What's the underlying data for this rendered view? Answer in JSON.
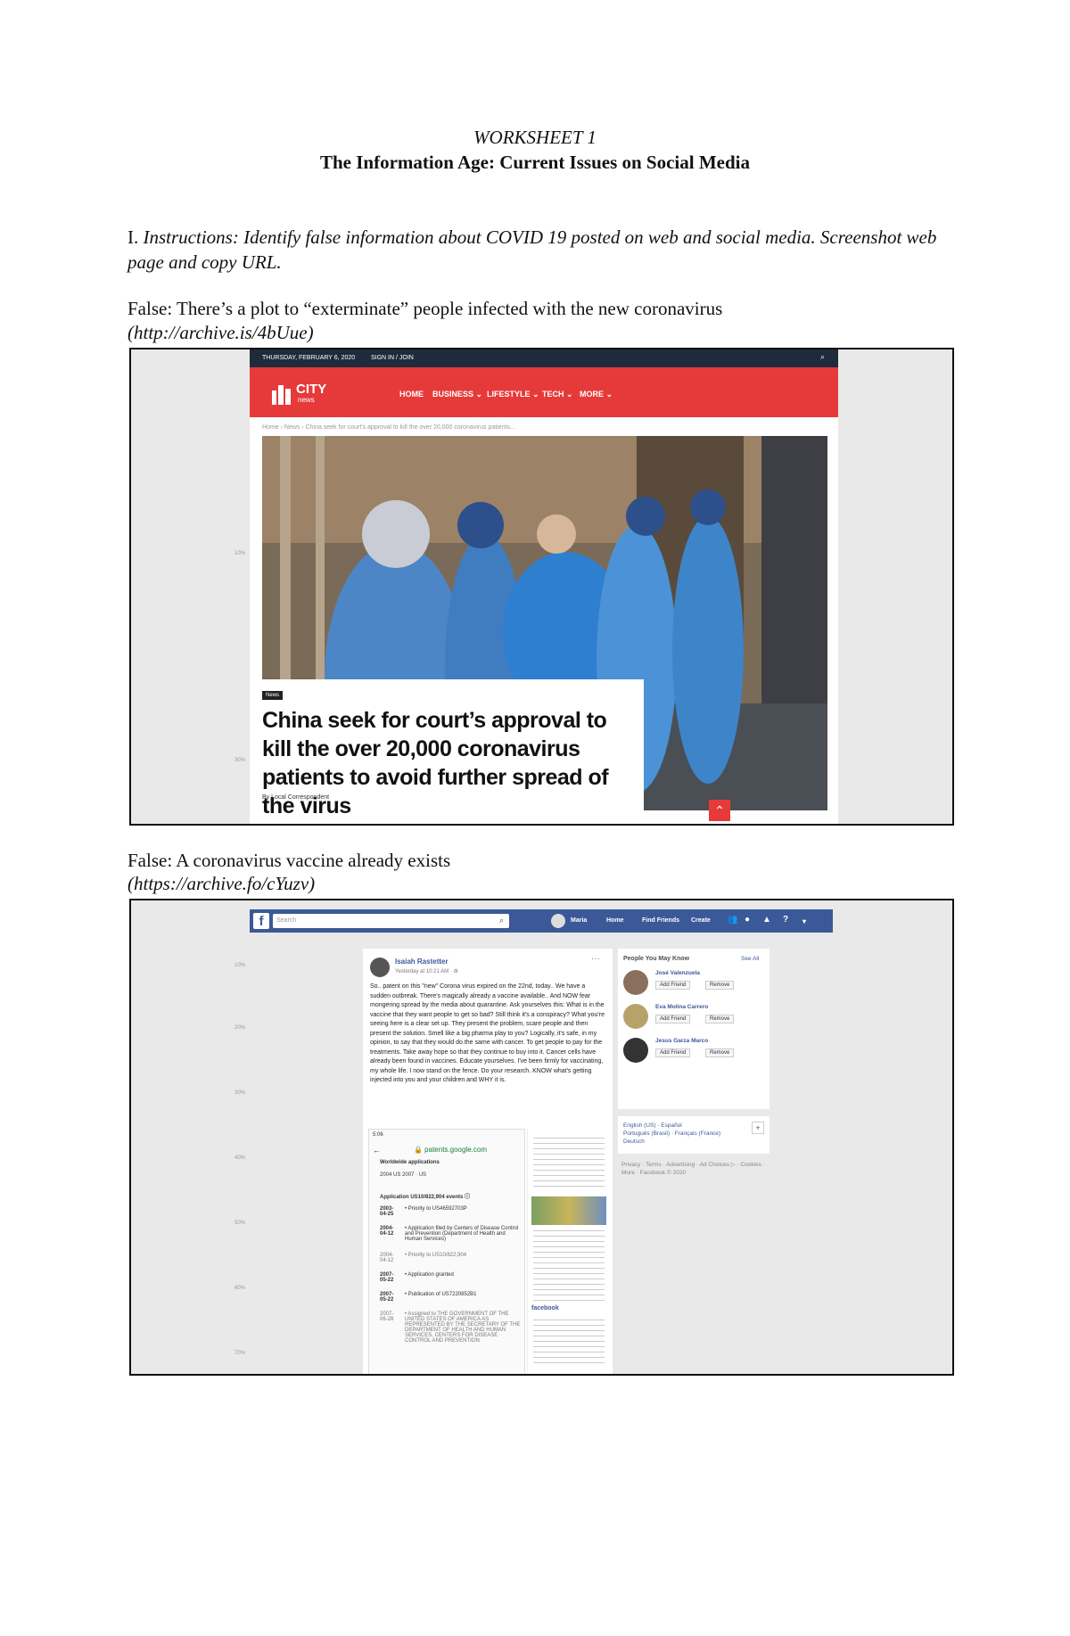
{
  "worksheet": {
    "title": "WORKSHEET 1",
    "subtitle": "The Information Age: Current Issues on Social Media",
    "instructions_number": "I.",
    "instructions_text": "Instructions: Identify false information about COVID 19 posted on web and social media. Screenshot web page and copy URL."
  },
  "items": [
    {
      "claim": "False: There’s a plot to “exterminate” people infected with the new coronavirus",
      "url": "(http://archive.is/4bUue)"
    },
    {
      "claim": "False: A coronavirus vaccine already exists",
      "url": "(https://archive.fo/cYuzv)"
    }
  ],
  "shot1": {
    "date": "THURSDAY, FEBRUARY 6, 2020",
    "signin": "SIGN IN / JOIN",
    "logo_top": "CITY",
    "logo_bottom": "news",
    "menu": [
      "HOME",
      "BUSINESS ⌄",
      "LIFESTYLE ⌄",
      "TECH ⌄",
      "MORE ⌄"
    ],
    "breadcrumb": "Home  ›  News  ›  China seek for court's approval to kill the over 20,000 coronavirus patients...",
    "badge": "News",
    "headline": "China seek for court’s approval to kill the over 20,000 coronavirus patients to avoid further spread of the virus",
    "author": "By  Local Correspondent",
    "side_ticks": [
      "10%",
      "30%"
    ]
  },
  "shot2": {
    "search_placeholder": "Search",
    "nav": [
      "Maria",
      "Home",
      "Find Friends",
      "Create"
    ],
    "poster": "Isaiah Rastetter",
    "time": "Yesterday at 10:21 AM · ⚙",
    "post_text": "So.. patent on this \"new\" Corona virus expired on the 22nd, today.. We have a sudden outbreak. There's magically already a vaccine available.. And NOW fear mongering spread by the media about quarantine. Ask yourselves this: What is in the vaccine that they want people to get so bad? Still think it's a conspiracy? What you're seeing here is a clear set up. They present the problem, scare people and then present the solution. Smell like a big pharma play to you? Logically, it's safe, in my opinion, to say that they would do the same with cancer. To get people to pay for the treatments. Take away hope so that they continue to buy into it. Cancer cells have already been found in vaccines. Educate yourselves. I've been firmly for vaccinating, my whole life. I now stand on the fence. Do your research. KNOW what's getting injected into you and your children and WHY it is.",
    "phone": {
      "clock": "5:06",
      "site": "🔒 patents.google.com",
      "section": "Worldwide applications",
      "years": "2004  US  2007 · US",
      "events_title": "Application US10/822,904 events ⓘ",
      "events": [
        {
          "date": "2003-04-25",
          "text": "• Priority to US46592703P"
        },
        {
          "date": "2004-04-12",
          "text": "• Application filed by Centers of Disease Control and Prevention (Department of Health and Human Services)"
        },
        {
          "date": "2004-04-12",
          "text": "• Priority to US10/822,904"
        },
        {
          "date": "2007-05-22",
          "text": "• Application granted"
        },
        {
          "date": "2007-05-22",
          "text": "• Publication of US7220852B1"
        },
        {
          "date": "2007-06-28",
          "text": "• Assigned to THE GOVERNMENT OF THE UNITED STATES OF AMERICA AS REPRESENTED BY THE SECRETARY OF THE DEPARTMENT OF HEALTH AND HUMAN SERVICES, CENTERS FOR DISEASE CONTROL AND PREVENTION"
        }
      ]
    },
    "strip_label": "facebook",
    "pymk_title": "People You May Know",
    "see_all": "See All",
    "people": [
      "José Valenzuela",
      "Eva Molina Carrero",
      "Jesus Garza Marco"
    ],
    "add_friend": "Add Friend",
    "remove": "Remove",
    "langs": "English (US) · Español\nPortuguês (Brasil) · Français (France)\nDeutsch",
    "footer": "Privacy · Terms · Advertising · Ad Choices ▷ · Cookies · More · Facebook © 2020",
    "side_ticks": [
      "10%",
      "20%",
      "30%",
      "40%",
      "50%",
      "60%",
      "70%"
    ]
  }
}
